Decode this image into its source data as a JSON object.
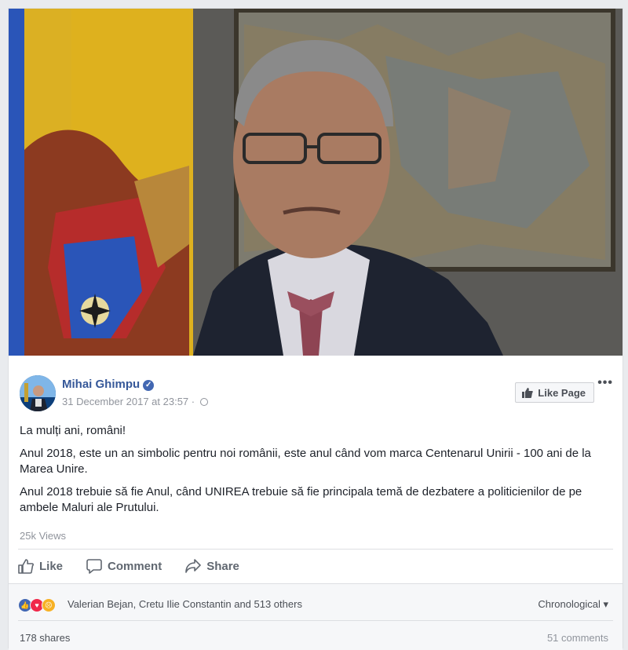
{
  "post": {
    "page_name": "Mihai Ghimpu",
    "timestamp": "31 December 2017 at 23:57",
    "meta_separator": "·",
    "like_page_label": "Like Page",
    "more_label": "•••",
    "paragraphs": [
      "La mulți ani, români!",
      "Anul 2018, este un an simbolic pentru noi românii, este anul când vom marca Centenarul Unirii - 100 ani de la Marea Unire.",
      "Anul 2018 trebuie să fie Anul, când UNIREA trebuie să fie principala temă de dezbatere a politicienilor de pe ambele Maluri ale Prutului."
    ],
    "views": "25k Views"
  },
  "actions": {
    "like": "Like",
    "comment": "Comment",
    "share": "Share"
  },
  "reactions": {
    "icons": [
      "like-reaction-icon",
      "love-reaction-icon",
      "angry-reaction-icon"
    ],
    "reactors": "Valerian Bejan, Cretu Ilie Constantin and 513 others",
    "sort_label": "Chronological ▾",
    "shares": "178 shares",
    "comments": "51 comments"
  },
  "colors": {
    "link": "#365899",
    "like_blue": "#4267b2",
    "love_red": "#f0284a",
    "angry_orange": "#f7714b"
  }
}
